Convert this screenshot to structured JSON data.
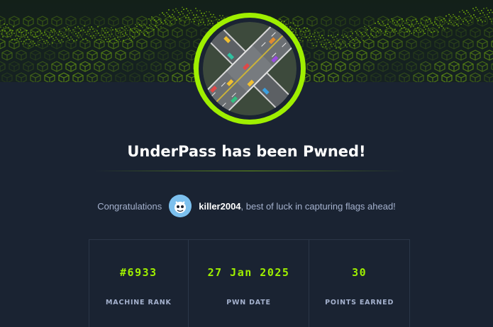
{
  "colors": {
    "background": "#1a2332",
    "accent": "#9fef00",
    "text_primary": "#ffffff",
    "text_secondary": "#a4b1cd",
    "border": "#2b3648"
  },
  "header": {
    "banner_icon": "green-hex-cube-wave-banner",
    "machine_badge_icon": "underpass-highway-machine-icon"
  },
  "title": "UnderPass has been Pwned!",
  "congrats": {
    "prefix": "Congratulations",
    "avatar_icon": "user-avatar-icon",
    "username": "killer2004",
    "suffix": ", best of luck in capturing flags ahead!"
  },
  "stats": [
    {
      "value": "#6933",
      "label": "MACHINE RANK"
    },
    {
      "value": "27 Jan 2025",
      "label": "PWN DATE"
    },
    {
      "value": "30",
      "label": "POINTS EARNED"
    }
  ]
}
